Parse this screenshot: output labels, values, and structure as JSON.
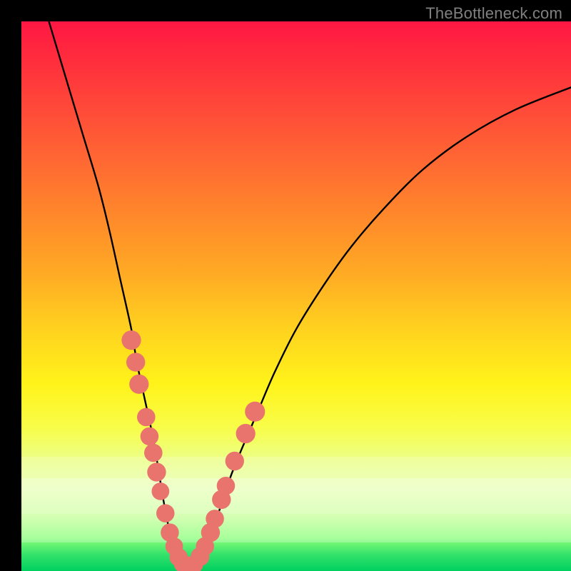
{
  "watermark": "TheBottleneck.com",
  "colors": {
    "curve_stroke": "#000000",
    "marker_fill": "#e8746d",
    "marker_stroke": "#c4534e",
    "background_black": "#000000",
    "gradient_top": "#ff1744",
    "gradient_bottom": "#00d060"
  },
  "chart_data": {
    "type": "line",
    "title": "",
    "xlabel": "",
    "ylabel": "",
    "xlim": [
      0,
      100
    ],
    "ylim": [
      0,
      100
    ],
    "grid": false,
    "legend": false,
    "note": "No axis ticks or numeric labels are rendered in the image; x and y values are estimated on a 0–100 normalized scale from pixel positions.",
    "series": [
      {
        "name": "bottleneck-curve",
        "x": [
          5,
          8,
          11,
          14,
          16,
          18,
          20,
          21,
          22.5,
          24,
          25,
          26,
          27,
          28,
          29,
          30.5,
          32,
          34,
          36,
          38,
          40,
          43,
          46,
          50,
          55,
          60,
          66,
          73,
          81,
          90,
          100
        ],
        "y": [
          100,
          90,
          80,
          70,
          62,
          53,
          44,
          38,
          31,
          24,
          18,
          12,
          7,
          3,
          1,
          0.5,
          2,
          6,
          11,
          17,
          22,
          29,
          36,
          44,
          52,
          59,
          66,
          73,
          79,
          84,
          88
        ]
      }
    ],
    "markers": [
      {
        "x": 20.0,
        "y": 42.0,
        "r": 1.8
      },
      {
        "x": 20.8,
        "y": 38.0,
        "r": 1.7
      },
      {
        "x": 21.4,
        "y": 34.0,
        "r": 1.8
      },
      {
        "x": 22.7,
        "y": 28.0,
        "r": 1.6
      },
      {
        "x": 23.3,
        "y": 24.5,
        "r": 1.6
      },
      {
        "x": 24.0,
        "y": 21.5,
        "r": 1.6
      },
      {
        "x": 24.6,
        "y": 18.0,
        "r": 1.7
      },
      {
        "x": 25.3,
        "y": 14.5,
        "r": 1.5
      },
      {
        "x": 26.2,
        "y": 10.5,
        "r": 1.6
      },
      {
        "x": 27.0,
        "y": 7.0,
        "r": 1.6
      },
      {
        "x": 27.8,
        "y": 4.5,
        "r": 1.5
      },
      {
        "x": 28.6,
        "y": 2.5,
        "r": 1.6
      },
      {
        "x": 29.4,
        "y": 1.3,
        "r": 1.6
      },
      {
        "x": 30.4,
        "y": 0.8,
        "r": 1.6
      },
      {
        "x": 31.4,
        "y": 1.2,
        "r": 1.6
      },
      {
        "x": 32.5,
        "y": 2.6,
        "r": 1.7
      },
      {
        "x": 33.4,
        "y": 4.5,
        "r": 1.6
      },
      {
        "x": 34.4,
        "y": 7.0,
        "r": 1.7
      },
      {
        "x": 35.2,
        "y": 9.5,
        "r": 1.6
      },
      {
        "x": 36.4,
        "y": 13.0,
        "r": 1.7
      },
      {
        "x": 37.2,
        "y": 15.5,
        "r": 1.6
      },
      {
        "x": 38.8,
        "y": 20.0,
        "r": 1.7
      },
      {
        "x": 40.8,
        "y": 25.0,
        "r": 1.8
      },
      {
        "x": 42.5,
        "y": 29.0,
        "r": 1.9
      }
    ]
  }
}
